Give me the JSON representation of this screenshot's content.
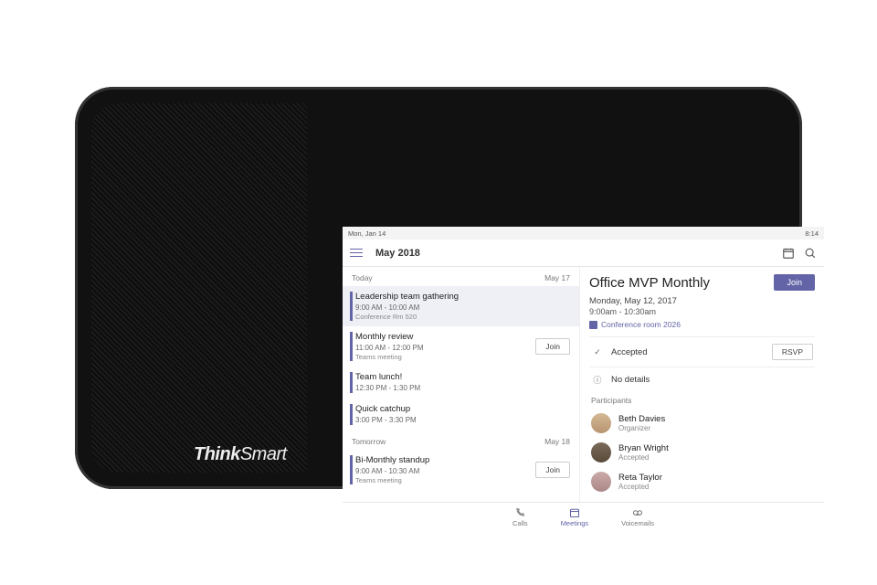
{
  "device_brand": "ThinkSmart",
  "status": {
    "date": "Mon, Jan 14",
    "time": "8:14"
  },
  "header": {
    "title": "May 2018"
  },
  "days": [
    {
      "label": "Today",
      "date": "May 17",
      "events": [
        {
          "title": "Leadership team gathering",
          "time": "9:00 AM - 10:00 AM",
          "location": "Conference Rm 520",
          "selected": true
        },
        {
          "title": "Monthly review",
          "time": "11:00 AM - 12:00 PM",
          "location": "Teams meeting",
          "join": "Join"
        },
        {
          "title": "Team lunch!",
          "time": "12:30 PM - 1:30 PM"
        },
        {
          "title": "Quick catchup",
          "time": "3:00 PM - 3:30 PM"
        }
      ]
    },
    {
      "label": "Tomorrow",
      "date": "May 18",
      "events": [
        {
          "title": "Bi-Monthly standup",
          "time": "9:00 AM - 10:30 AM",
          "location": "Teams meeting",
          "join": "Join"
        }
      ]
    }
  ],
  "detail": {
    "title": "Office MVP Monthly",
    "join": "Join",
    "date": "Monday, May 12, 2017",
    "time": "9:00am - 10:30am",
    "room": "Conference room 2026",
    "status": "Accepted",
    "rsvp": "RSVP",
    "no_details": "No details",
    "participants_label": "Participants",
    "participants": [
      {
        "name": "Beth Davies",
        "status": "Organizer"
      },
      {
        "name": "Bryan Wright",
        "status": "Accepted"
      },
      {
        "name": "Reta Taylor",
        "status": "Accepted"
      }
    ]
  },
  "nav": {
    "calls": "Calls",
    "meetings": "Meetings",
    "voicemails": "Voicemails"
  }
}
